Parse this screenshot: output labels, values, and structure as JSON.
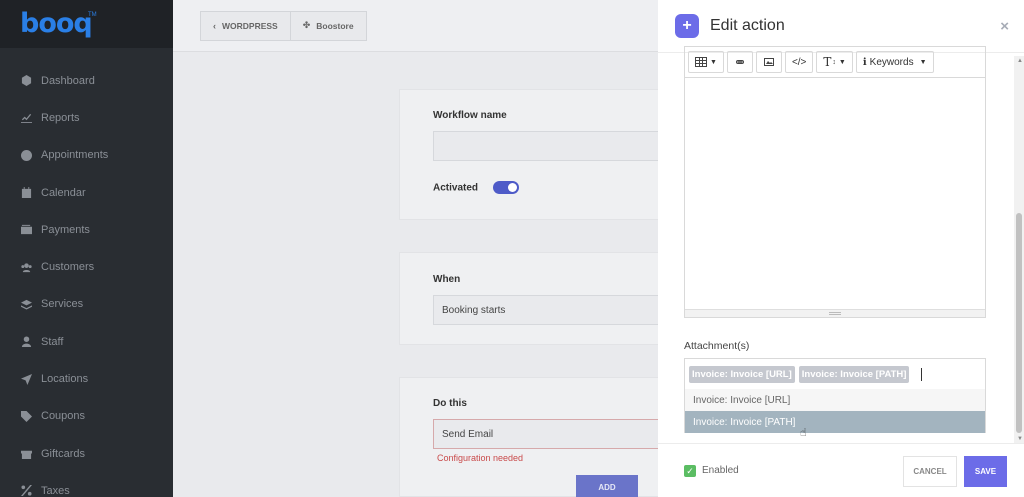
{
  "sidebar": {
    "logo": "booq",
    "logo_tm": "TM",
    "items": [
      {
        "label": "Dashboard",
        "icon": "cube-icon"
      },
      {
        "label": "Reports",
        "icon": "chart-icon"
      },
      {
        "label": "Appointments",
        "icon": "clock-icon"
      },
      {
        "label": "Calendar",
        "icon": "calendar-icon"
      },
      {
        "label": "Payments",
        "icon": "wallet-icon"
      },
      {
        "label": "Customers",
        "icon": "users-icon"
      },
      {
        "label": "Services",
        "icon": "layers-icon"
      },
      {
        "label": "Staff",
        "icon": "user-icon"
      },
      {
        "label": "Locations",
        "icon": "location-arrow-icon"
      },
      {
        "label": "Coupons",
        "icon": "tag-icon"
      },
      {
        "label": "Giftcards",
        "icon": "gift-icon"
      },
      {
        "label": "Taxes",
        "icon": "percent-icon"
      }
    ]
  },
  "breadcrumb": {
    "back": "WORDPRESS",
    "current": "Boostore"
  },
  "workflow": {
    "name_label": "Workflow name",
    "name_value": "",
    "activated_label": "Activated",
    "when_label": "When",
    "when_value": "Booking starts",
    "do_label": "Do this",
    "do_value": "Send Email",
    "do_error": "Configuration needed",
    "add_label": "ADD"
  },
  "panel": {
    "title": "Edit action",
    "close": "×",
    "toolbar": {
      "keywords": "Keywords",
      "code": "</>",
      "text_size": "T"
    },
    "attachments_label": "Attachment(s)",
    "attachment_tags": [
      "Invoice: Invoice [URL]",
      "Invoice: Invoice [PATH]"
    ],
    "options": [
      "Invoice: Invoice [URL]",
      "Invoice: Invoice [PATH]"
    ],
    "enabled_label": "Enabled",
    "cancel_label": "CANCEL",
    "save_label": "SAVE"
  },
  "colors": {
    "accent": "#6c6ce8",
    "sidebar_bg": "#292d32",
    "logo_blue": "#2a7fe6",
    "success": "#5bbd63",
    "error": "#c94b4b"
  }
}
